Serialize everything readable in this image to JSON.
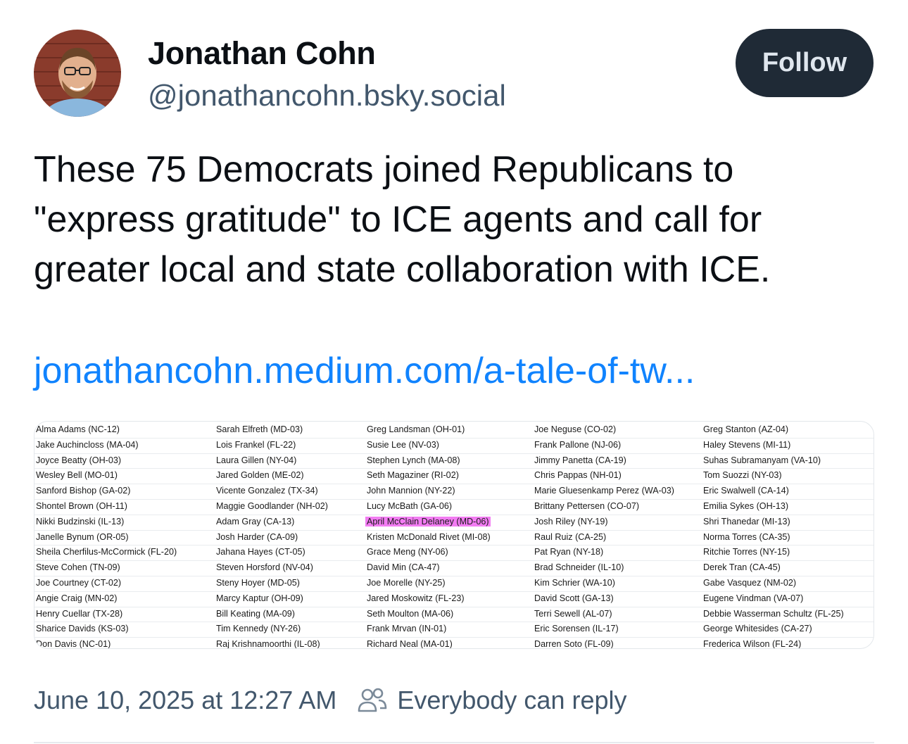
{
  "author": {
    "name": "Jonathan Cohn",
    "handle": "@jonathancohn.bsky.social"
  },
  "follow_label": "Follow",
  "post": {
    "text": "These 75 Democrats joined Republicans to \"express gratitude\" to ICE agents and call for greater local and state collaboration with ICE.",
    "link": "jonathancohn.medium.com/a-tale-of-tw..."
  },
  "embed_table": {
    "highlight_color": "#f27cf2",
    "columns": [
      [
        "Alma Adams (NC-12)",
        "Jake Auchincloss (MA-04)",
        "Joyce Beatty (OH-03)",
        "Wesley Bell (MO-01)",
        "Sanford Bishop (GA-02)",
        "Shontel Brown (OH-11)",
        "Nikki Budzinski (IL-13)",
        "Janelle Bynum (OR-05)",
        "Sheila Cherfilus-McCormick (FL-20)",
        "Steve Cohen (TN-09)",
        "Joe Courtney (CT-02)",
        "Angie Craig (MN-02)",
        "Henry Cuellar (TX-28)",
        "Sharice Davids (KS-03)",
        "Don Davis (NC-01)"
      ],
      [
        "Sarah Elfreth (MD-03)",
        "Lois Frankel (FL-22)",
        "Laura Gillen (NY-04)",
        "Jared Golden (ME-02)",
        "Vicente Gonzalez (TX-34)",
        "Maggie Goodlander (NH-02)",
        "Adam Gray (CA-13)",
        "Josh Harder (CA-09)",
        "Jahana Hayes (CT-05)",
        "Steven Horsford (NV-04)",
        "Steny Hoyer (MD-05)",
        "Marcy Kaptur (OH-09)",
        "Bill Keating (MA-09)",
        "Tim Kennedy (NY-26)",
        "Raj Krishnamoorthi (IL-08)"
      ],
      [
        "Greg Landsman (OH-01)",
        "Susie Lee (NV-03)",
        "Stephen Lynch (MA-08)",
        "Seth Magaziner (RI-02)",
        "John Mannion (NY-22)",
        "Lucy McBath (GA-06)",
        "April McClain Delaney (MD-06)",
        "Kristen McDonald Rivet (MI-08)",
        "Grace Meng (NY-06)",
        "David Min (CA-47)",
        "Joe Morelle (NY-25)",
        "Jared Moskowitz (FL-23)",
        "Seth Moulton (MA-06)",
        "Frank Mrvan (IN-01)",
        "Richard Neal (MA-01)"
      ],
      [
        "Joe Neguse (CO-02)",
        "Frank Pallone (NJ-06)",
        "Jimmy Panetta (CA-19)",
        "Chris Pappas (NH-01)",
        "Marie Gluesenkamp Perez (WA-03)",
        "Brittany Pettersen (CO-07)",
        "Josh Riley (NY-19)",
        "Raul Ruiz (CA-25)",
        "Pat Ryan (NY-18)",
        "Brad Schneider (IL-10)",
        "Kim Schrier (WA-10)",
        "David Scott (GA-13)",
        "Terri Sewell (AL-07)",
        "Eric Sorensen (IL-17)",
        "Darren Soto (FL-09)"
      ],
      [
        "Greg Stanton (AZ-04)",
        "Haley Stevens (MI-11)",
        "Suhas Subramanyam (VA-10)",
        "Tom Suozzi (NY-03)",
        "Eric Swalwell (CA-14)",
        "Emilia Sykes (OH-13)",
        "Shri Thanedar (MI-13)",
        "Norma Torres (CA-35)",
        "Ritchie Torres (NY-15)",
        "Derek Tran (CA-45)",
        "Gabe Vasquez (NM-02)",
        "Eugene Vindman (VA-07)",
        "Debbie Wasserman Schultz (FL-25)",
        "George Whitesides (CA-27)",
        "Frederica Wilson (FL-24)"
      ]
    ],
    "highlighted": "April McClain Delaney (MD-06)"
  },
  "meta": {
    "timestamp": "June 10, 2025 at 12:27 AM",
    "reply_setting": "Everybody can reply"
  },
  "icons": [
    "avatar-photo",
    "people-icon"
  ]
}
